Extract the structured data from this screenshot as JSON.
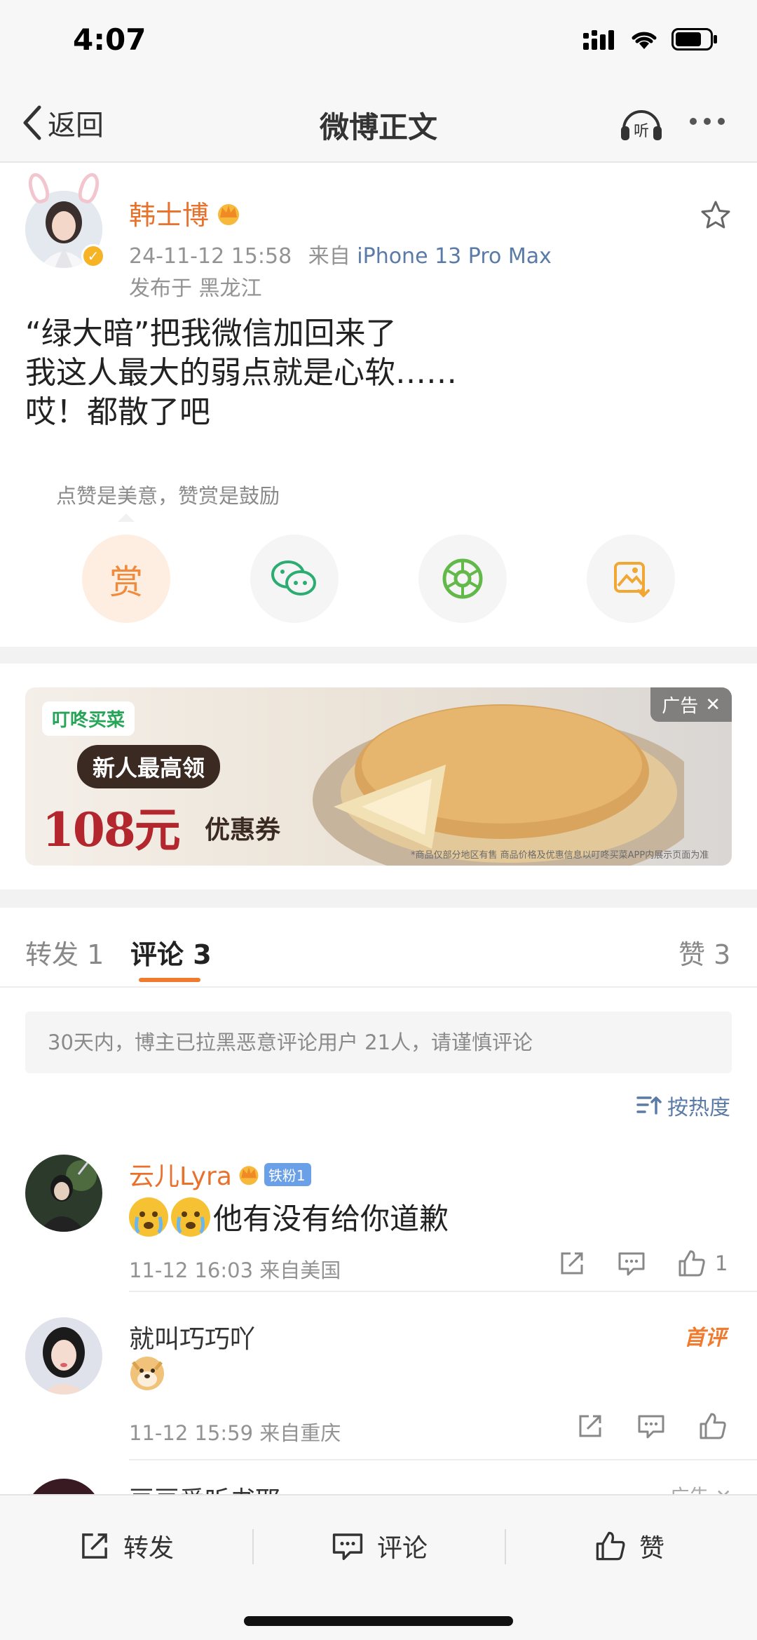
{
  "status_bar": {
    "time": "4:07"
  },
  "nav": {
    "back_label": "返回",
    "title": "微博正文",
    "listen_label": "听"
  },
  "post": {
    "author": "韩士博",
    "timestamp": "24-11-12 15:58",
    "source_prefix": "来自",
    "device": "iPhone 13 Pro Max",
    "location": "发布于 黑龙江",
    "lines": [
      "“绿大暗”把我微信加回来了",
      "我这人最大的弱点就是心软……",
      "哎！都散了吧"
    ],
    "reward_tip": "点赞是美意，赞赏是鼓励",
    "reward_label": "赏"
  },
  "ad": {
    "brand": "叮咚买菜",
    "headline": "新人最高领",
    "amount": "108元",
    "coupon": "优惠券",
    "tag": "广告",
    "disclaimer": "*商品仅部分地区有售 商品价格及优惠信息以叮咚买菜APP内展示页面为准"
  },
  "tabs": {
    "repost": "转发 1",
    "comment": "评论 3",
    "like": "赞 3"
  },
  "notice": "30天内，博主已拉黑恶意评论用户 21人，请谨慎评论",
  "sort_label": "按热度",
  "comments": [
    {
      "name": "云儿Lyra",
      "fan_badge": "铁粉1",
      "text": "他有没有给你道歉",
      "meta": "11-12 16:03  来自美国",
      "likes": "1"
    },
    {
      "name": "就叫巧巧吖",
      "first_tag": "首评",
      "meta": "11-12 15:59  来自重庆"
    },
    {
      "name": "豆豆爱听书耶",
      "tag": "广告"
    }
  ],
  "bottom_bar": {
    "repost": "转发",
    "comment": "评论",
    "like": "赞"
  },
  "colors": {
    "accent": "#f07b2f",
    "username": "#e8712b",
    "link": "#5a7ba8"
  }
}
